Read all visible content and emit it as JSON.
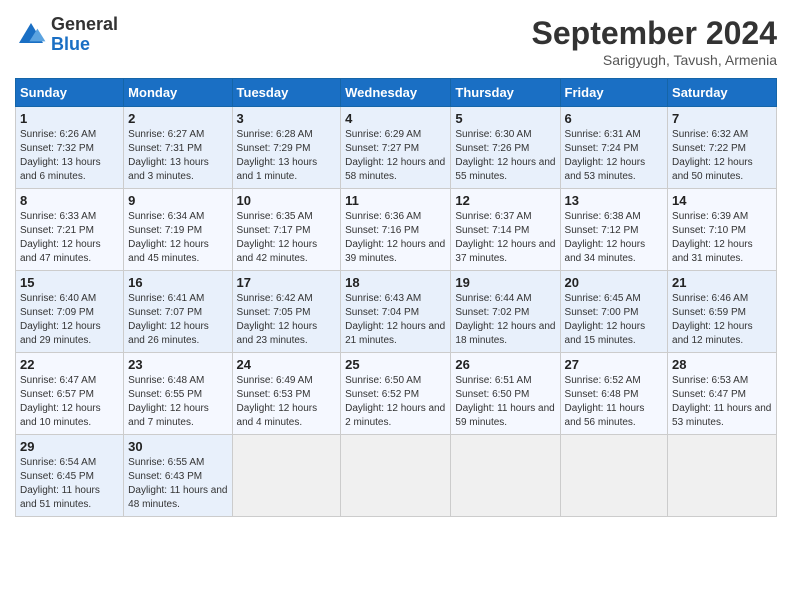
{
  "header": {
    "logo_general": "General",
    "logo_blue": "Blue",
    "month_title": "September 2024",
    "subtitle": "Sarigyugh, Tavush, Armenia"
  },
  "days_of_week": [
    "Sunday",
    "Monday",
    "Tuesday",
    "Wednesday",
    "Thursday",
    "Friday",
    "Saturday"
  ],
  "weeks": [
    [
      {
        "day": "1",
        "sunrise": "6:26 AM",
        "sunset": "7:32 PM",
        "daylight": "13 hours and 6 minutes."
      },
      {
        "day": "2",
        "sunrise": "6:27 AM",
        "sunset": "7:31 PM",
        "daylight": "13 hours and 3 minutes."
      },
      {
        "day": "3",
        "sunrise": "6:28 AM",
        "sunset": "7:29 PM",
        "daylight": "13 hours and 1 minute."
      },
      {
        "day": "4",
        "sunrise": "6:29 AM",
        "sunset": "7:27 PM",
        "daylight": "12 hours and 58 minutes."
      },
      {
        "day": "5",
        "sunrise": "6:30 AM",
        "sunset": "7:26 PM",
        "daylight": "12 hours and 55 minutes."
      },
      {
        "day": "6",
        "sunrise": "6:31 AM",
        "sunset": "7:24 PM",
        "daylight": "12 hours and 53 minutes."
      },
      {
        "day": "7",
        "sunrise": "6:32 AM",
        "sunset": "7:22 PM",
        "daylight": "12 hours and 50 minutes."
      }
    ],
    [
      {
        "day": "8",
        "sunrise": "6:33 AM",
        "sunset": "7:21 PM",
        "daylight": "12 hours and 47 minutes."
      },
      {
        "day": "9",
        "sunrise": "6:34 AM",
        "sunset": "7:19 PM",
        "daylight": "12 hours and 45 minutes."
      },
      {
        "day": "10",
        "sunrise": "6:35 AM",
        "sunset": "7:17 PM",
        "daylight": "12 hours and 42 minutes."
      },
      {
        "day": "11",
        "sunrise": "6:36 AM",
        "sunset": "7:16 PM",
        "daylight": "12 hours and 39 minutes."
      },
      {
        "day": "12",
        "sunrise": "6:37 AM",
        "sunset": "7:14 PM",
        "daylight": "12 hours and 37 minutes."
      },
      {
        "day": "13",
        "sunrise": "6:38 AM",
        "sunset": "7:12 PM",
        "daylight": "12 hours and 34 minutes."
      },
      {
        "day": "14",
        "sunrise": "6:39 AM",
        "sunset": "7:10 PM",
        "daylight": "12 hours and 31 minutes."
      }
    ],
    [
      {
        "day": "15",
        "sunrise": "6:40 AM",
        "sunset": "7:09 PM",
        "daylight": "12 hours and 29 minutes."
      },
      {
        "day": "16",
        "sunrise": "6:41 AM",
        "sunset": "7:07 PM",
        "daylight": "12 hours and 26 minutes."
      },
      {
        "day": "17",
        "sunrise": "6:42 AM",
        "sunset": "7:05 PM",
        "daylight": "12 hours and 23 minutes."
      },
      {
        "day": "18",
        "sunrise": "6:43 AM",
        "sunset": "7:04 PM",
        "daylight": "12 hours and 21 minutes."
      },
      {
        "day": "19",
        "sunrise": "6:44 AM",
        "sunset": "7:02 PM",
        "daylight": "12 hours and 18 minutes."
      },
      {
        "day": "20",
        "sunrise": "6:45 AM",
        "sunset": "7:00 PM",
        "daylight": "12 hours and 15 minutes."
      },
      {
        "day": "21",
        "sunrise": "6:46 AM",
        "sunset": "6:59 PM",
        "daylight": "12 hours and 12 minutes."
      }
    ],
    [
      {
        "day": "22",
        "sunrise": "6:47 AM",
        "sunset": "6:57 PM",
        "daylight": "12 hours and 10 minutes."
      },
      {
        "day": "23",
        "sunrise": "6:48 AM",
        "sunset": "6:55 PM",
        "daylight": "12 hours and 7 minutes."
      },
      {
        "day": "24",
        "sunrise": "6:49 AM",
        "sunset": "6:53 PM",
        "daylight": "12 hours and 4 minutes."
      },
      {
        "day": "25",
        "sunrise": "6:50 AM",
        "sunset": "6:52 PM",
        "daylight": "12 hours and 2 minutes."
      },
      {
        "day": "26",
        "sunrise": "6:51 AM",
        "sunset": "6:50 PM",
        "daylight": "11 hours and 59 minutes."
      },
      {
        "day": "27",
        "sunrise": "6:52 AM",
        "sunset": "6:48 PM",
        "daylight": "11 hours and 56 minutes."
      },
      {
        "day": "28",
        "sunrise": "6:53 AM",
        "sunset": "6:47 PM",
        "daylight": "11 hours and 53 minutes."
      }
    ],
    [
      {
        "day": "29",
        "sunrise": "6:54 AM",
        "sunset": "6:45 PM",
        "daylight": "11 hours and 51 minutes."
      },
      {
        "day": "30",
        "sunrise": "6:55 AM",
        "sunset": "6:43 PM",
        "daylight": "11 hours and 48 minutes."
      },
      null,
      null,
      null,
      null,
      null
    ]
  ],
  "labels": {
    "sunrise": "Sunrise:",
    "sunset": "Sunset:",
    "daylight": "Daylight:"
  }
}
